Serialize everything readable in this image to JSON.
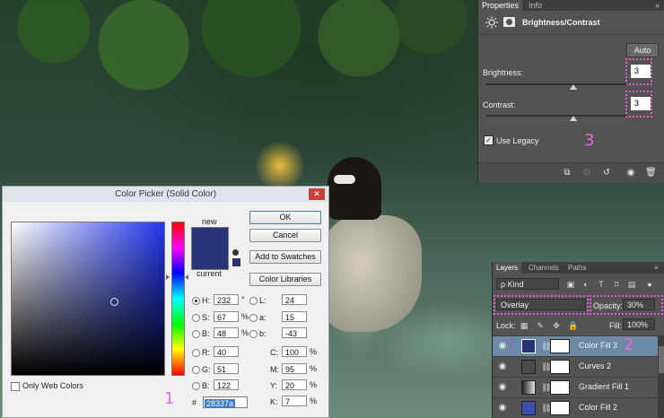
{
  "properties": {
    "tabs": [
      "Properties",
      "Info"
    ],
    "menu_glyph": "»",
    "adjustment_title": "Brightness/Contrast",
    "auto_label": "Auto",
    "brightness_label": "Brightness:",
    "brightness_value": "3",
    "contrast_label": "Contrast:",
    "contrast_value": "3",
    "use_legacy_label": "Use Legacy",
    "use_legacy_checked": true,
    "annotation": "3"
  },
  "color_picker": {
    "title": "Color Picker (Solid Color)",
    "new_label": "new",
    "current_label": "current",
    "new_color": "#28337a",
    "current_color": "#28337a",
    "buttons": [
      "OK",
      "Cancel",
      "Add to Swatches",
      "Color Libraries"
    ],
    "fields": {
      "H": {
        "label": "H:",
        "value": "232",
        "unit": "°"
      },
      "S": {
        "label": "S:",
        "value": "67",
        "unit": "%"
      },
      "B": {
        "label": "B:",
        "value": "48",
        "unit": "%"
      },
      "R": {
        "label": "R:",
        "value": "40"
      },
      "G": {
        "label": "G:",
        "value": "51"
      },
      "Bl": {
        "label": "B:",
        "value": "122"
      },
      "L": {
        "label": "L:",
        "value": "24"
      },
      "a": {
        "label": "a:",
        "value": "15"
      },
      "b": {
        "label": "b:",
        "value": "-43"
      },
      "C": {
        "label": "C:",
        "value": "100",
        "unit": "%"
      },
      "M": {
        "label": "M:",
        "value": "95",
        "unit": "%"
      },
      "Y": {
        "label": "Y:",
        "value": "20",
        "unit": "%"
      },
      "K": {
        "label": "K:",
        "value": "7",
        "unit": "%"
      }
    },
    "hex_prefix": "#",
    "hex_value": "28337a",
    "only_web_colors_label": "Only Web Colors",
    "annotation": "1",
    "close_glyph": "✕"
  },
  "layers": {
    "tabs": [
      "Layers",
      "Channels",
      "Paths"
    ],
    "menu_glyph": "≡",
    "filter_label": "ρ Kind",
    "blend_mode": "Overlay",
    "opacity_label": "Opacity:",
    "opacity_value": "30%",
    "lock_label": "Lock:",
    "fill_label": "Fill:",
    "fill_value": "100%",
    "annotation": "2",
    "rows": [
      {
        "name": "Color Fill 3",
        "selected": true,
        "thumb_color": "#28337a"
      },
      {
        "name": "Curves 2",
        "selected": false,
        "thumb_color": "#4a4a4a"
      },
      {
        "name": "Gradient Fill 1",
        "selected": false,
        "thumb_color": "#777777"
      },
      {
        "name": "Color Fill 2",
        "selected": false,
        "thumb_color": "#3b4fb0"
      }
    ]
  }
}
